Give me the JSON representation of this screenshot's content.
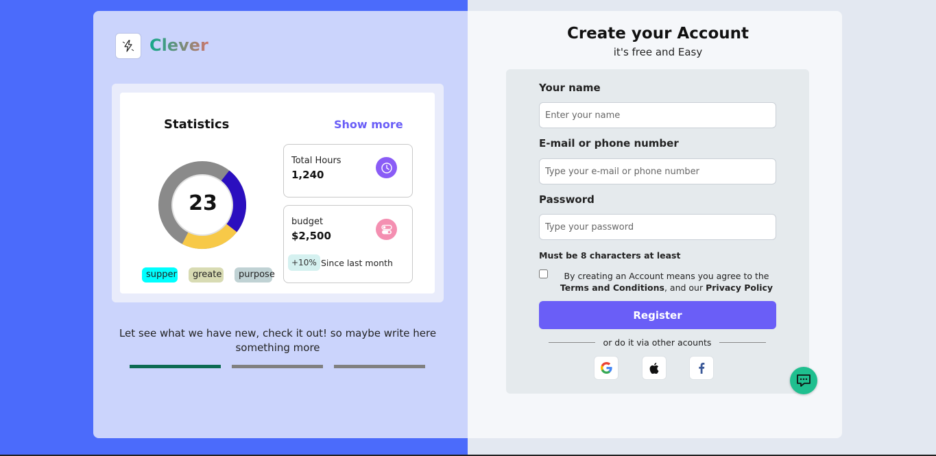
{
  "brand": {
    "name": "Clever"
  },
  "stats": {
    "title": "Statistics",
    "show_more": "Show more",
    "donut_value": "23",
    "donut_segments": [
      {
        "name": "blue",
        "fraction": 0.25,
        "color": "#2b0fbf"
      },
      {
        "name": "yellow",
        "fraction": 0.22,
        "color": "#f7c948"
      },
      {
        "name": "gray",
        "fraction": 0.53,
        "color": "#8a8a8a"
      }
    ],
    "tags": [
      "supper",
      "greate",
      "purpose"
    ],
    "total_hours": {
      "label": "Total Hours",
      "value": "1,240",
      "icon": "clock-icon",
      "color": "#8a5cf6"
    },
    "budget": {
      "label": "budget",
      "value": "$2,500",
      "icon": "toggle-icon",
      "color": "#f48fb1",
      "growth": "+10%",
      "growth_text": "Since last month"
    }
  },
  "tagline": "Let see what we have new, check it out! so maybe write here something more",
  "carousel": {
    "active_index": 0,
    "count": 3
  },
  "form": {
    "title": "Create your Account",
    "subtitle": "it's free and Easy",
    "name_label": "Your name",
    "name_placeholder": "Enter your name",
    "email_label": "E-mail or phone number",
    "email_placeholder": "Type your e-mail or phone number",
    "password_label": "Password",
    "password_placeholder": "Type your password",
    "password_hint": "Must be 8 characters at least",
    "terms_prefix": "By creating an Account means you agree to the ",
    "terms_link": "Terms and Conditions",
    "terms_middle": ", and our ",
    "privacy_link": "Privacy Policy",
    "register_label": "Register",
    "or_text": "or do it via other acounts",
    "social": [
      "google-icon",
      "apple-icon",
      "facebook-icon"
    ]
  },
  "colors": {
    "accent": "#6a5ef7",
    "left_bg": "#4b6bfb",
    "chat": "#1fbf8f"
  }
}
